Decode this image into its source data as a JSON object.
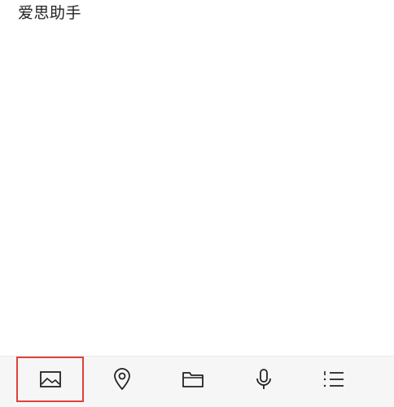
{
  "note": {
    "text": "爱思助手"
  },
  "toolbar": {
    "items": [
      {
        "id": "image",
        "icon": "image-icon",
        "selected": true
      },
      {
        "id": "location",
        "icon": "location-pin-icon",
        "selected": false
      },
      {
        "id": "folder",
        "icon": "folder-icon",
        "selected": false
      },
      {
        "id": "voice",
        "icon": "microphone-icon",
        "selected": false
      },
      {
        "id": "list",
        "icon": "numbered-list-icon",
        "selected": false
      }
    ],
    "highlight_color": "#e0413a",
    "icon_color": "#222222",
    "background": "#f6f6f6"
  }
}
